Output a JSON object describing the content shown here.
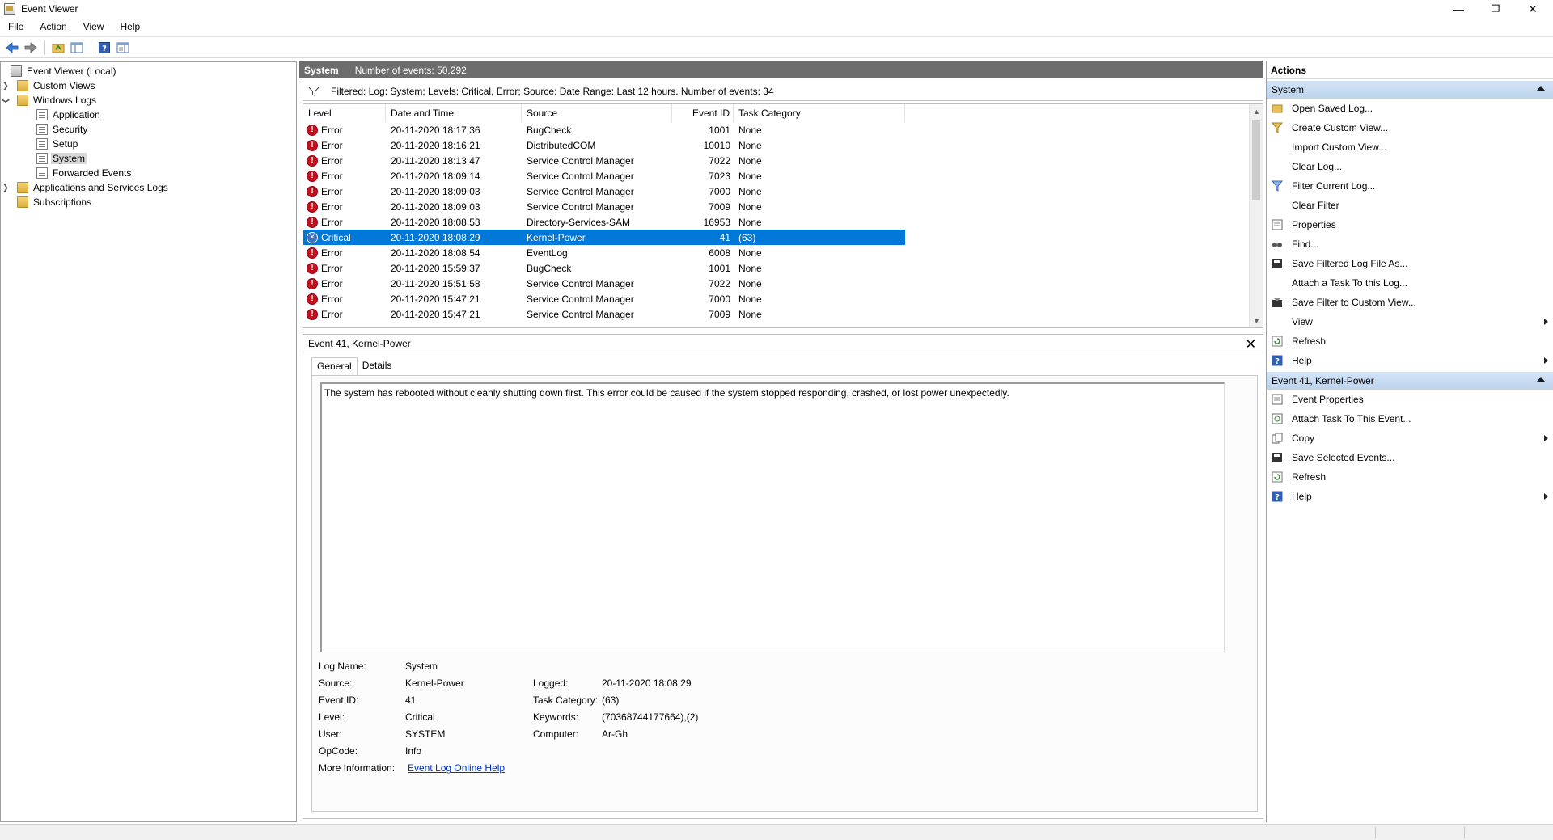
{
  "window": {
    "title": "Event Viewer",
    "controls": {
      "minimize": "—",
      "restore": "❐",
      "close": "✕"
    }
  },
  "menu": [
    "File",
    "Action",
    "View",
    "Help"
  ],
  "toolbar": {
    "buttons": [
      "back-arrow-icon",
      "forward-arrow-icon",
      "folder-up-icon",
      "show-hide-tree-icon",
      "help-icon",
      "properties-pane-icon"
    ]
  },
  "tree": {
    "root": "Event Viewer (Local)",
    "custom_views": "Custom Views",
    "windows_logs": "Windows Logs",
    "windows_logs_children": [
      "Application",
      "Security",
      "Setup",
      "System",
      "Forwarded Events"
    ],
    "apps_services": "Applications and Services Logs",
    "subscriptions": "Subscriptions",
    "selected": "System"
  },
  "center": {
    "header_name": "System",
    "header_count": "Number of events: 50,292",
    "filter_text": "Filtered: Log: System; Levels: Critical, Error; Source: Date Range: Last 12 hours. Number of events: 34",
    "columns": [
      "Level",
      "Date and Time",
      "Source",
      "Event ID",
      "Task Category"
    ],
    "rows": [
      {
        "level": "Error",
        "datetime": "20-11-2020 18:17:36",
        "source": "BugCheck",
        "event_id": "1001",
        "task": "None"
      },
      {
        "level": "Error",
        "datetime": "20-11-2020 18:16:21",
        "source": "DistributedCOM",
        "event_id": "10010",
        "task": "None"
      },
      {
        "level": "Error",
        "datetime": "20-11-2020 18:13:47",
        "source": "Service Control Manager",
        "event_id": "7022",
        "task": "None"
      },
      {
        "level": "Error",
        "datetime": "20-11-2020 18:09:14",
        "source": "Service Control Manager",
        "event_id": "7023",
        "task": "None"
      },
      {
        "level": "Error",
        "datetime": "20-11-2020 18:09:03",
        "source": "Service Control Manager",
        "event_id": "7000",
        "task": "None"
      },
      {
        "level": "Error",
        "datetime": "20-11-2020 18:09:03",
        "source": "Service Control Manager",
        "event_id": "7009",
        "task": "None"
      },
      {
        "level": "Error",
        "datetime": "20-11-2020 18:08:53",
        "source": "Directory-Services-SAM",
        "event_id": "16953",
        "task": "None"
      },
      {
        "level": "Critical",
        "datetime": "20-11-2020 18:08:29",
        "source": "Kernel-Power",
        "event_id": "41",
        "task": "(63)"
      },
      {
        "level": "Error",
        "datetime": "20-11-2020 18:08:54",
        "source": "EventLog",
        "event_id": "6008",
        "task": "None"
      },
      {
        "level": "Error",
        "datetime": "20-11-2020 15:59:37",
        "source": "BugCheck",
        "event_id": "1001",
        "task": "None"
      },
      {
        "level": "Error",
        "datetime": "20-11-2020 15:51:58",
        "source": "Service Control Manager",
        "event_id": "7022",
        "task": "None"
      },
      {
        "level": "Error",
        "datetime": "20-11-2020 15:47:21",
        "source": "Service Control Manager",
        "event_id": "7000",
        "task": "None"
      },
      {
        "level": "Error",
        "datetime": "20-11-2020 15:47:21",
        "source": "Service Control Manager",
        "event_id": "7009",
        "task": "None"
      }
    ],
    "selected_row": 7
  },
  "detail": {
    "title": "Event 41, Kernel-Power",
    "close": "✕",
    "tabs": [
      "General",
      "Details"
    ],
    "active_tab": "General",
    "description": "The system has rebooted without cleanly shutting down first. This error could be caused if the system stopped responding, crashed, or lost power unexpectedly.",
    "props": {
      "log_name_label": "Log Name:",
      "log_name": "System",
      "source_label": "Source:",
      "source": "Kernel-Power",
      "logged_label": "Logged:",
      "logged": "20-11-2020 18:08:29",
      "event_id_label": "Event ID:",
      "event_id": "41",
      "task_category_label": "Task Category:",
      "task_category": "(63)",
      "level_label": "Level:",
      "level": "Critical",
      "keywords_label": "Keywords:",
      "keywords": "(70368744177664),(2)",
      "user_label": "User:",
      "user": "SYSTEM",
      "computer_label": "Computer:",
      "computer": "Ar-Gh",
      "opcode_label": "OpCode:",
      "opcode": "Info",
      "more_info_label": "More Information:",
      "more_info_link": "Event Log Online Help"
    }
  },
  "actions": {
    "header": "Actions",
    "section1_title": "System",
    "section1_items": [
      {
        "label": "Open Saved Log...",
        "icon": "open-log-icon",
        "submenu": false
      },
      {
        "label": "Create Custom View...",
        "icon": "create-view-icon",
        "submenu": false
      },
      {
        "label": "Import Custom View...",
        "icon": "",
        "submenu": false
      },
      {
        "label": "Clear Log...",
        "icon": "",
        "submenu": false
      },
      {
        "label": "Filter Current Log...",
        "icon": "filter-icon",
        "submenu": false
      },
      {
        "label": "Clear Filter",
        "icon": "",
        "submenu": false
      },
      {
        "label": "Properties",
        "icon": "properties-icon",
        "submenu": false
      },
      {
        "label": "Find...",
        "icon": "find-icon",
        "submenu": false
      },
      {
        "label": "Save Filtered Log File As...",
        "icon": "save-icon",
        "submenu": false
      },
      {
        "label": "Attach a Task To this Log...",
        "icon": "",
        "submenu": false
      },
      {
        "label": "Save Filter to Custom View...",
        "icon": "save-filter-icon",
        "submenu": false
      },
      {
        "label": "View",
        "icon": "",
        "submenu": true
      },
      {
        "label": "Refresh",
        "icon": "refresh-icon",
        "submenu": false
      },
      {
        "label": "Help",
        "icon": "help-icon",
        "submenu": true
      }
    ],
    "section2_title": "Event 41, Kernel-Power",
    "section2_items": [
      {
        "label": "Event Properties",
        "icon": "event-properties-icon",
        "submenu": false
      },
      {
        "label": "Attach Task To This Event...",
        "icon": "attach-task-icon",
        "submenu": false
      },
      {
        "label": "Copy",
        "icon": "copy-icon",
        "submenu": true
      },
      {
        "label": "Save Selected Events...",
        "icon": "save-icon",
        "submenu": false
      },
      {
        "label": "Refresh",
        "icon": "refresh-icon",
        "submenu": false
      },
      {
        "label": "Help",
        "icon": "help-icon",
        "submenu": true
      }
    ]
  },
  "colors": {
    "selection": "#0078d7",
    "header_bar": "#6d6d6d",
    "section_header": "#c6daf1",
    "error": "#c50f1f",
    "critical": "#3a6fc4",
    "link": "#0033cc"
  }
}
